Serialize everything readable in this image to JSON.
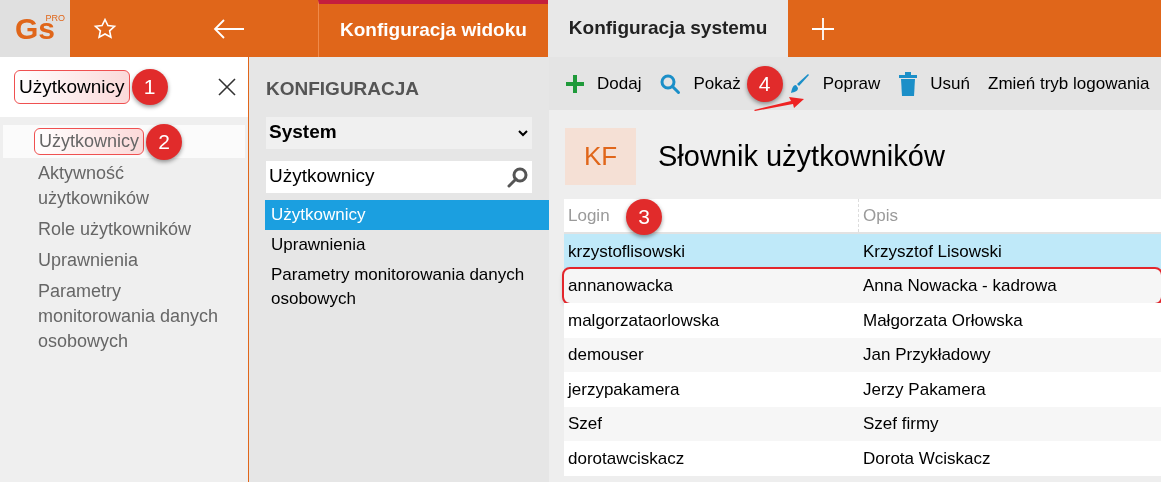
{
  "logo": {
    "text": "Gs",
    "superscript": "PRO"
  },
  "tabs": [
    {
      "label": "Konfiguracja widoku",
      "selected": false
    },
    {
      "label": "Konfiguracja systemu",
      "selected": true
    }
  ],
  "sidebar": {
    "search": {
      "value": "Użytkownicy",
      "highlighted": true,
      "badge": "1"
    },
    "items": [
      {
        "label": "Użytkownicy",
        "selected": true,
        "highlighted": true,
        "badge": "2"
      },
      {
        "label": "Aktywność użytkowników",
        "selected": false,
        "highlighted": false
      },
      {
        "label": "Role użytkowników",
        "selected": false,
        "highlighted": false
      },
      {
        "label": "Uprawnienia",
        "selected": false,
        "highlighted": false
      },
      {
        "label": "Parametry monitorowania danych osobowych",
        "selected": false,
        "highlighted": false
      }
    ]
  },
  "config": {
    "title": "KONFIGURACJA",
    "dropdown": "System",
    "search": {
      "value": "Użytkownicy"
    },
    "items": [
      {
        "label": "Użytkownicy",
        "selected": true
      },
      {
        "label": "Uprawnienia",
        "selected": false
      },
      {
        "label": "Parametry monitorowania danych osobowych",
        "selected": false
      }
    ]
  },
  "toolbar": {
    "buttons": [
      {
        "label": "Dodaj",
        "kind": "add"
      },
      {
        "label": "Pokaż",
        "kind": "show"
      },
      {
        "label": "Popraw",
        "kind": "edit"
      },
      {
        "label": "Usuń",
        "kind": "delete"
      },
      {
        "label": "Zmień tryb logowania",
        "kind": "text"
      }
    ],
    "badge": "4"
  },
  "page": {
    "initials": "KF",
    "title": "Słownik użytkowników"
  },
  "table": {
    "columns": [
      "Login",
      "Opis"
    ],
    "badge": "3",
    "rows": [
      {
        "cells": [
          "krzystoflisowski",
          "Krzysztof Lisowski"
        ],
        "selected": true,
        "outlined": false
      },
      {
        "cells": [
          "annanowacka",
          "Anna Nowacka - kadrowa"
        ],
        "selected": false,
        "outlined": true
      },
      {
        "cells": [
          "malgorzataorlowska",
          "Małgorzata Orłowska"
        ],
        "selected": false,
        "outlined": false
      },
      {
        "cells": [
          "demouser",
          "Jan Przykładowy"
        ],
        "selected": false,
        "outlined": false
      },
      {
        "cells": [
          "jerzypakamera",
          "Jerzy Pakamera"
        ],
        "selected": false,
        "outlined": false
      },
      {
        "cells": [
          "Szef",
          "Szef firmy"
        ],
        "selected": false,
        "outlined": false
      },
      {
        "cells": [
          "dorotawciskacz",
          "Dorota Wciskacz"
        ],
        "selected": false,
        "outlined": false
      }
    ]
  }
}
